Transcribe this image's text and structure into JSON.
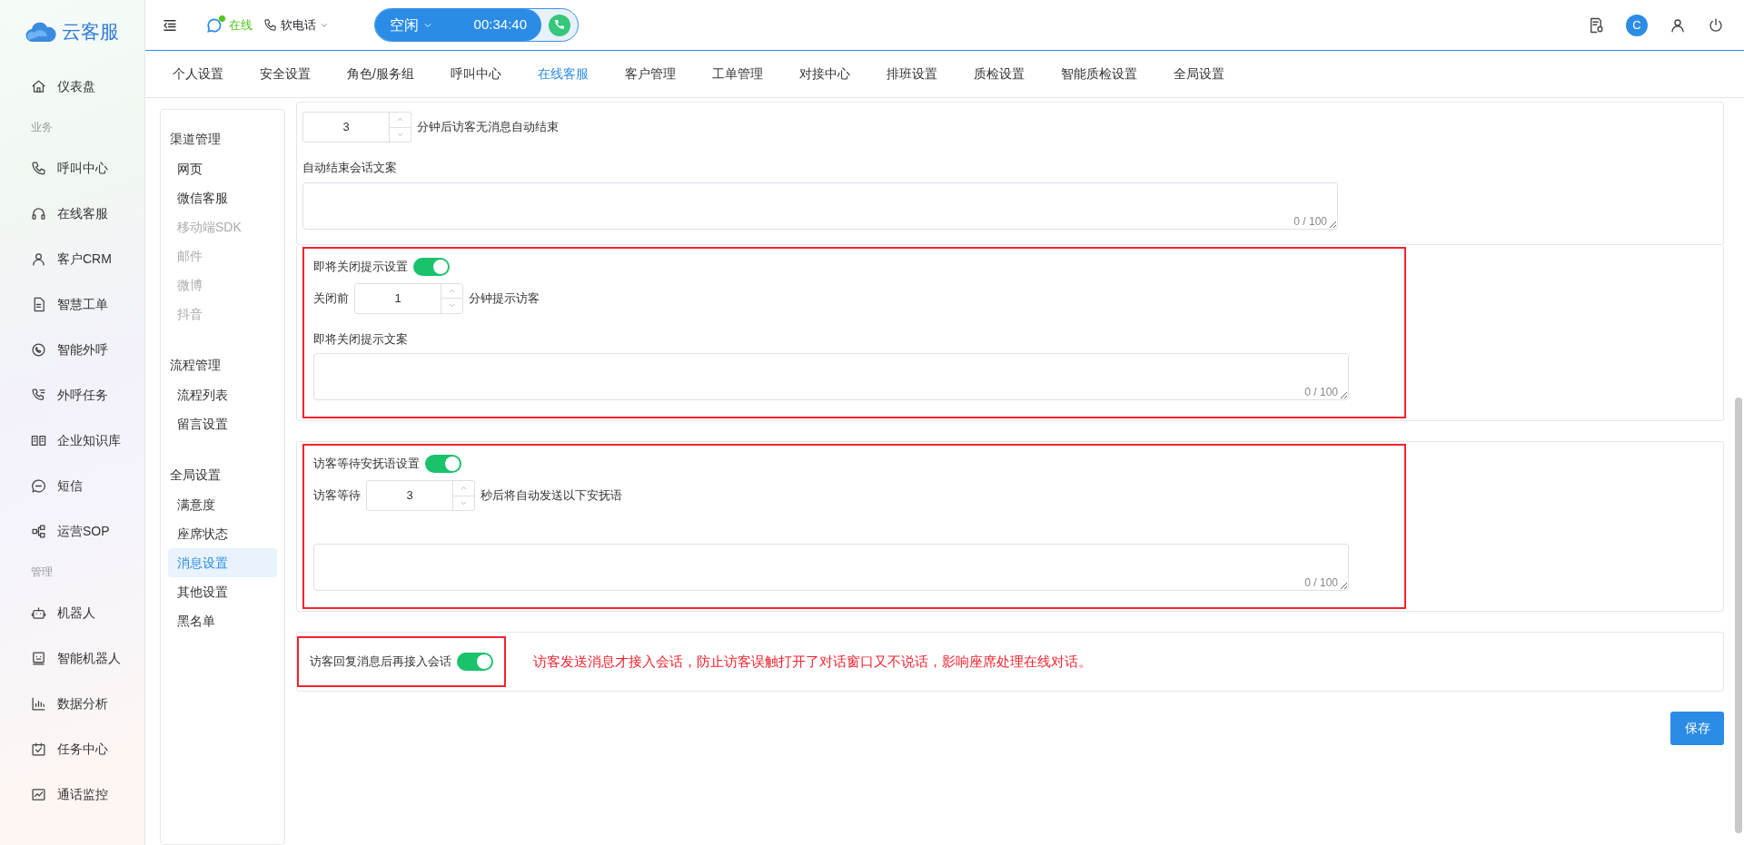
{
  "sidebar": {
    "logo": "云客服",
    "items": [
      {
        "kind": "item",
        "label": "仪表盘"
      },
      {
        "kind": "section",
        "label": "业务"
      },
      {
        "kind": "item",
        "label": "呼叫中心"
      },
      {
        "kind": "item",
        "label": "在线客服"
      },
      {
        "kind": "item",
        "label": "客户CRM"
      },
      {
        "kind": "item",
        "label": "智慧工单"
      },
      {
        "kind": "item",
        "label": "智能外呼"
      },
      {
        "kind": "item",
        "label": "外呼任务"
      },
      {
        "kind": "item",
        "label": "企业知识库"
      },
      {
        "kind": "item",
        "label": "短信"
      },
      {
        "kind": "item",
        "label": "运营SOP"
      },
      {
        "kind": "section",
        "label": "管理"
      },
      {
        "kind": "item",
        "label": "机器人"
      },
      {
        "kind": "item",
        "label": "智能机器人"
      },
      {
        "kind": "item",
        "label": "数据分析"
      },
      {
        "kind": "item",
        "label": "任务中心"
      },
      {
        "kind": "item",
        "label": "通话监控"
      }
    ]
  },
  "topbar": {
    "online_status": "在线",
    "online": true,
    "softphone": "软电话",
    "call": {
      "state": "空闲",
      "timer": "00:34:40"
    },
    "avatar": "C"
  },
  "tabs": [
    {
      "label": "个人设置",
      "selected": false
    },
    {
      "label": "安全设置",
      "selected": false
    },
    {
      "label": "角色/服务组",
      "selected": false
    },
    {
      "label": "呼叫中心",
      "selected": false
    },
    {
      "label": "在线客服",
      "selected": true
    },
    {
      "label": "客户管理",
      "selected": false
    },
    {
      "label": "工单管理",
      "selected": false
    },
    {
      "label": "对接中心",
      "selected": false
    },
    {
      "label": "排班设置",
      "selected": false
    },
    {
      "label": "质检设置",
      "selected": false
    },
    {
      "label": "智能质检设置",
      "selected": false
    },
    {
      "label": "全局设置",
      "selected": false
    }
  ],
  "subnav": [
    {
      "title": "渠道管理",
      "items": [
        {
          "label": "网页",
          "disabled": false,
          "selected": false
        },
        {
          "label": "微信客服",
          "disabled": false,
          "selected": false
        },
        {
          "label": "移动端SDK",
          "disabled": true,
          "selected": false
        },
        {
          "label": "邮件",
          "disabled": true,
          "selected": false
        },
        {
          "label": "微博",
          "disabled": true,
          "selected": false
        },
        {
          "label": "抖音",
          "disabled": true,
          "selected": false
        }
      ]
    },
    {
      "title": "流程管理",
      "items": [
        {
          "label": "流程列表",
          "disabled": false,
          "selected": false
        },
        {
          "label": "留言设置",
          "disabled": false,
          "selected": false
        }
      ]
    },
    {
      "title": "全局设置",
      "items": [
        {
          "label": "满意度",
          "disabled": false,
          "selected": false
        },
        {
          "label": "座席状态",
          "disabled": false,
          "selected": false
        },
        {
          "label": "消息设置",
          "disabled": false,
          "selected": true
        },
        {
          "label": "其他设置",
          "disabled": false,
          "selected": false
        },
        {
          "label": "黑名单",
          "disabled": false,
          "selected": false
        }
      ]
    }
  ],
  "sections": [
    {
      "highlighted": false,
      "rows": [
        {
          "kind": "number",
          "value": "3",
          "suffix": "分钟后访客无消息自动结束"
        },
        {
          "kind": "label",
          "text": "自动结束会话文案"
        },
        {
          "kind": "textarea",
          "counter": "0 / 100"
        }
      ]
    },
    {
      "highlighted": true,
      "rows": [
        {
          "kind": "toggle",
          "label": "即将关闭提示设置",
          "on": true
        },
        {
          "kind": "number",
          "prefix": "关闭前",
          "value": "1",
          "suffix": "分钟提示访客"
        },
        {
          "kind": "label",
          "text": "即将关闭提示文案"
        },
        {
          "kind": "textarea",
          "counter": "0 / 100"
        }
      ]
    },
    {
      "highlighted": true,
      "rows": [
        {
          "kind": "toggle",
          "label": "访客等待安抚语设置",
          "on": true
        },
        {
          "kind": "number",
          "prefix": "访客等待",
          "value": "3",
          "suffix": "秒后将自动发送以下安抚语"
        },
        {
          "kind": "textarea",
          "counter": "0 / 100"
        }
      ]
    },
    {
      "highlighted": true,
      "rows": [
        {
          "kind": "toggle",
          "label": "访客回复消息后再接入会话",
          "on": true,
          "note": "访客发送消息才接入会话，防止访客误触打开了对话窗口又不说话，影响座席处理在线对话。"
        }
      ]
    }
  ],
  "save": "保存"
}
